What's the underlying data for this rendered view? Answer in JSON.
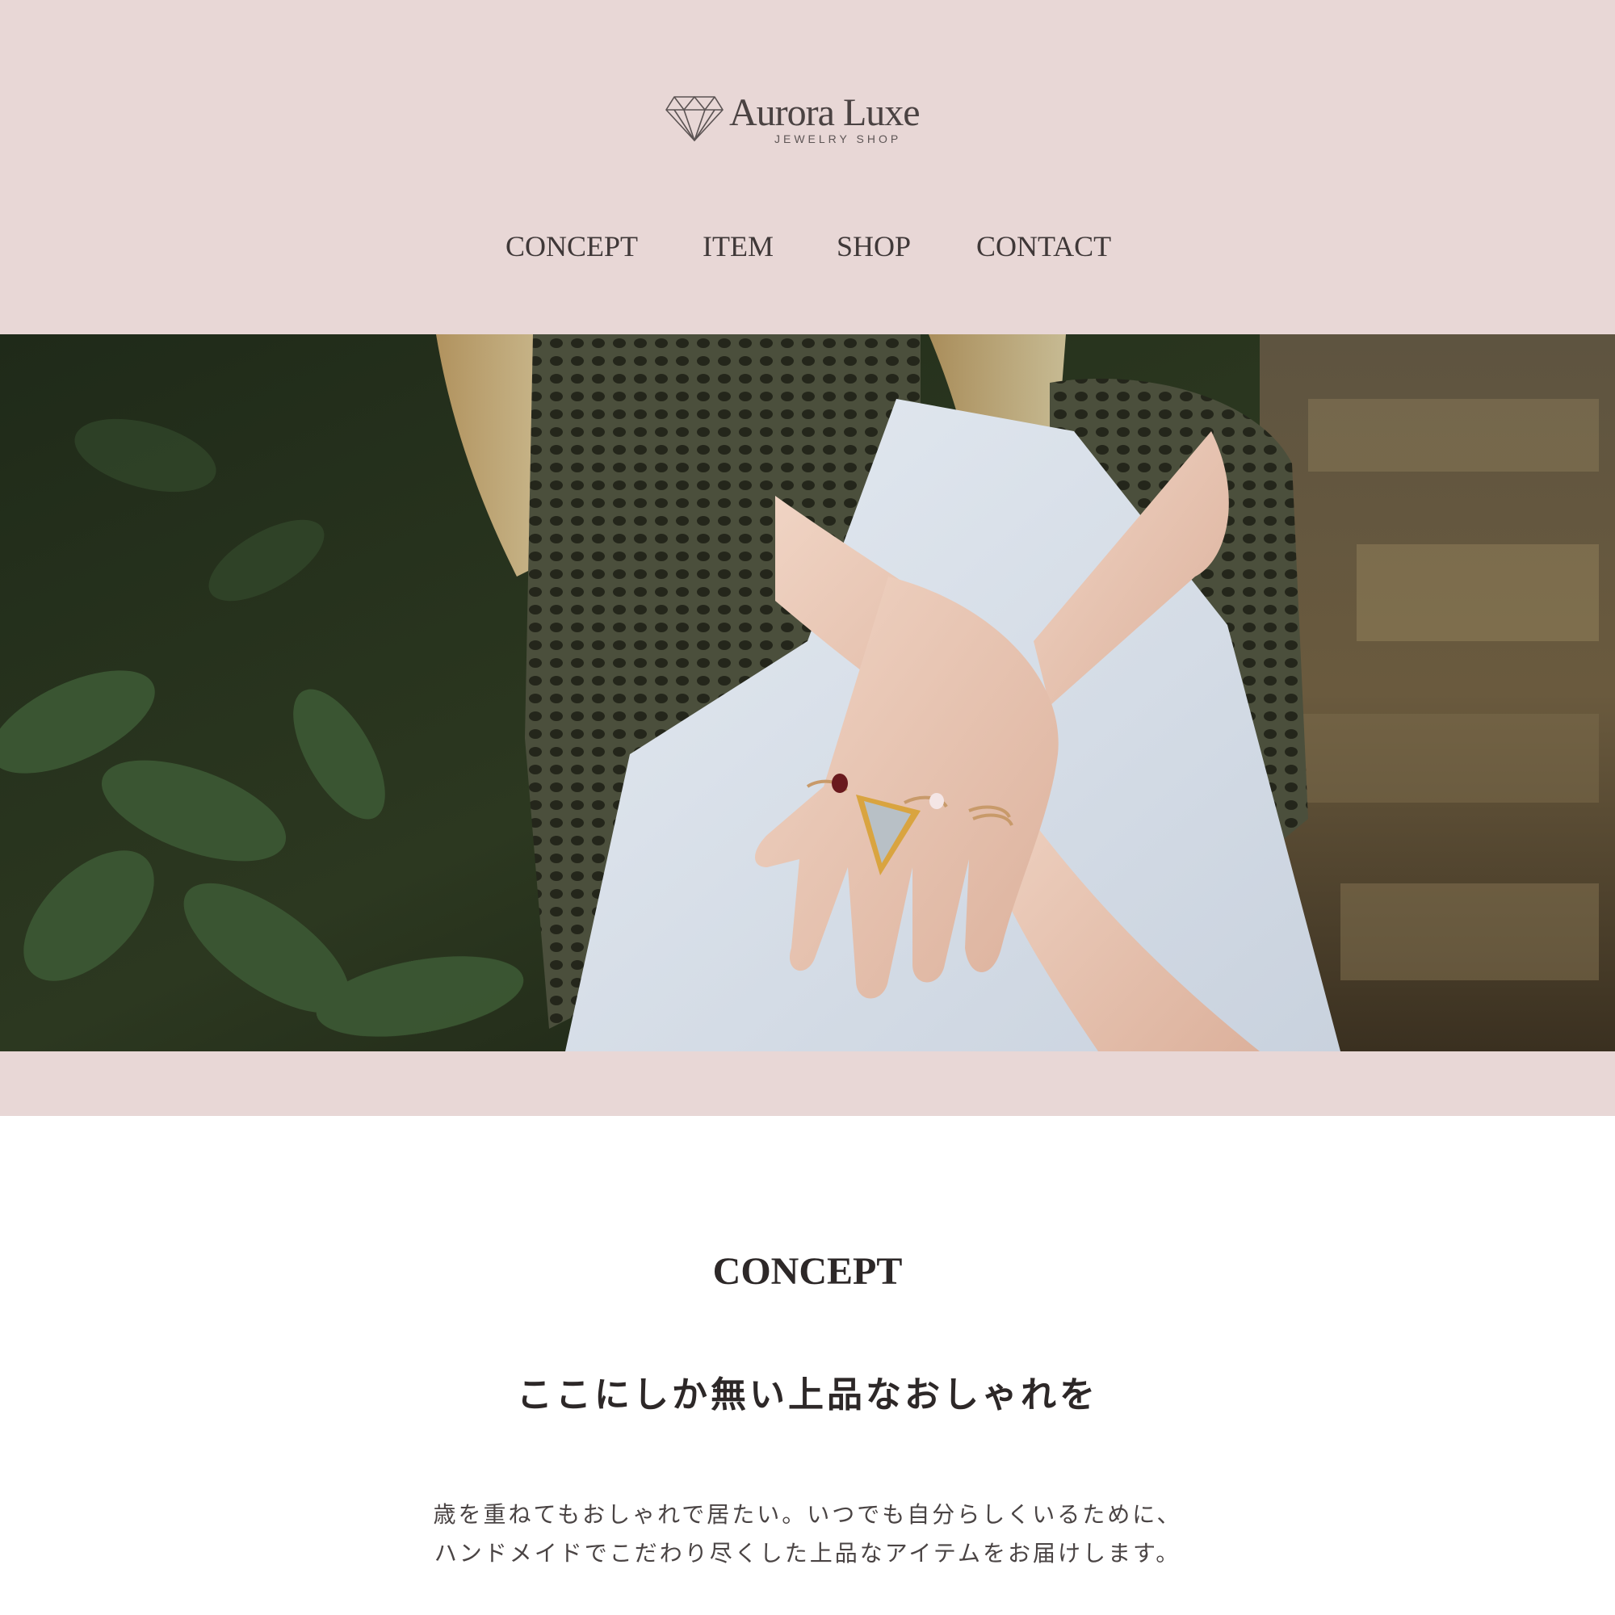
{
  "brand": {
    "name": "Aurora Luxe",
    "tagline": "JEWELRY SHOP",
    "logo_icon": "diamond-icon"
  },
  "nav": {
    "items": [
      {
        "label": "CONCEPT"
      },
      {
        "label": "ITEM"
      },
      {
        "label": "SHOP"
      },
      {
        "label": "CONTACT"
      }
    ]
  },
  "hero": {
    "image": "woman-hands-with-rings-photo"
  },
  "concept": {
    "title": "CONCEPT",
    "subtitle": "ここにしか無い上品なおしゃれを",
    "body_lines": [
      "歳を重ねてもおしゃれで居たい。いつでも自分らしくいるために、",
      "ハンドメイドでこだわり尽くした上品なアイテムをお届けします。"
    ]
  },
  "colors": {
    "header_bg": "#e8d7d6",
    "text": "#2d2828",
    "page_bg": "#ffffff"
  }
}
